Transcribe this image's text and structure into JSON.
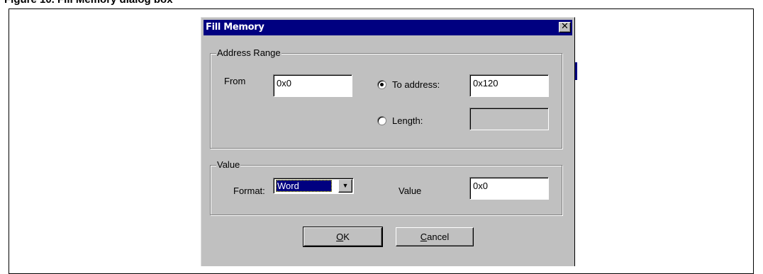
{
  "caption": "Figure 10.     Fill Memory dialog box",
  "dialog": {
    "title": "Fill Memory",
    "close_glyph": "✕"
  },
  "address_range": {
    "label": "Address Range",
    "from_label": "From",
    "from_value": "0x0",
    "to_address_label": "To address:",
    "to_address_value": "0x120",
    "to_address_selected": true,
    "length_label": "Length:",
    "length_value": "",
    "length_selected": false
  },
  "value_group": {
    "label": "Value",
    "format_label": "Format:",
    "format_selected": "Word",
    "value_label": "Value",
    "value_value": "0x0"
  },
  "buttons": {
    "ok_mnemonic": "O",
    "ok_rest": "K",
    "cancel_mnemonic": "C",
    "cancel_rest": "ancel"
  },
  "colors": {
    "titlebar": "#000080",
    "dialog_face": "#c0c0c0"
  },
  "icons": [
    "close-icon",
    "dropdown-arrow-icon",
    "radio-checked",
    "radio-unchecked"
  ]
}
